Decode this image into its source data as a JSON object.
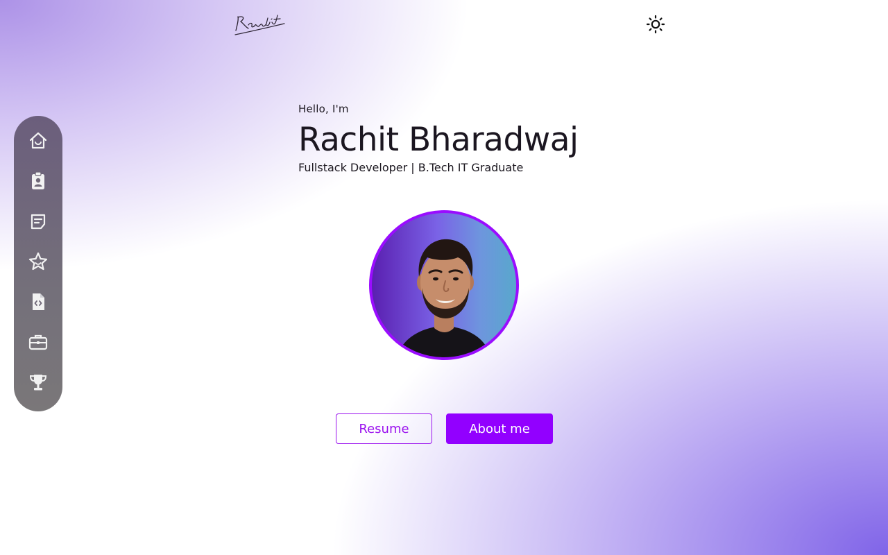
{
  "header": {
    "logo_alt": "Rachit",
    "theme_toggle_icon": "sun-icon"
  },
  "sidebar": {
    "items": [
      {
        "name": "home",
        "icon": "home-icon"
      },
      {
        "name": "about",
        "icon": "id-badge-icon"
      },
      {
        "name": "blog",
        "icon": "notes-icon"
      },
      {
        "name": "skills",
        "icon": "star-icon"
      },
      {
        "name": "projects",
        "icon": "code-file-icon"
      },
      {
        "name": "experience",
        "icon": "briefcase-icon"
      },
      {
        "name": "achievements",
        "icon": "trophy-icon"
      }
    ]
  },
  "hero": {
    "greeting": "Hello, I'm",
    "name": "Rachit Bharadwaj",
    "tagline": "Fullstack Developer | B.Tech IT Graduate"
  },
  "buttons": {
    "resume": "Resume",
    "about": "About me"
  },
  "colors": {
    "accent": "#9200ff",
    "sidebar_bg": "#74707a",
    "text": "#1c1820"
  }
}
